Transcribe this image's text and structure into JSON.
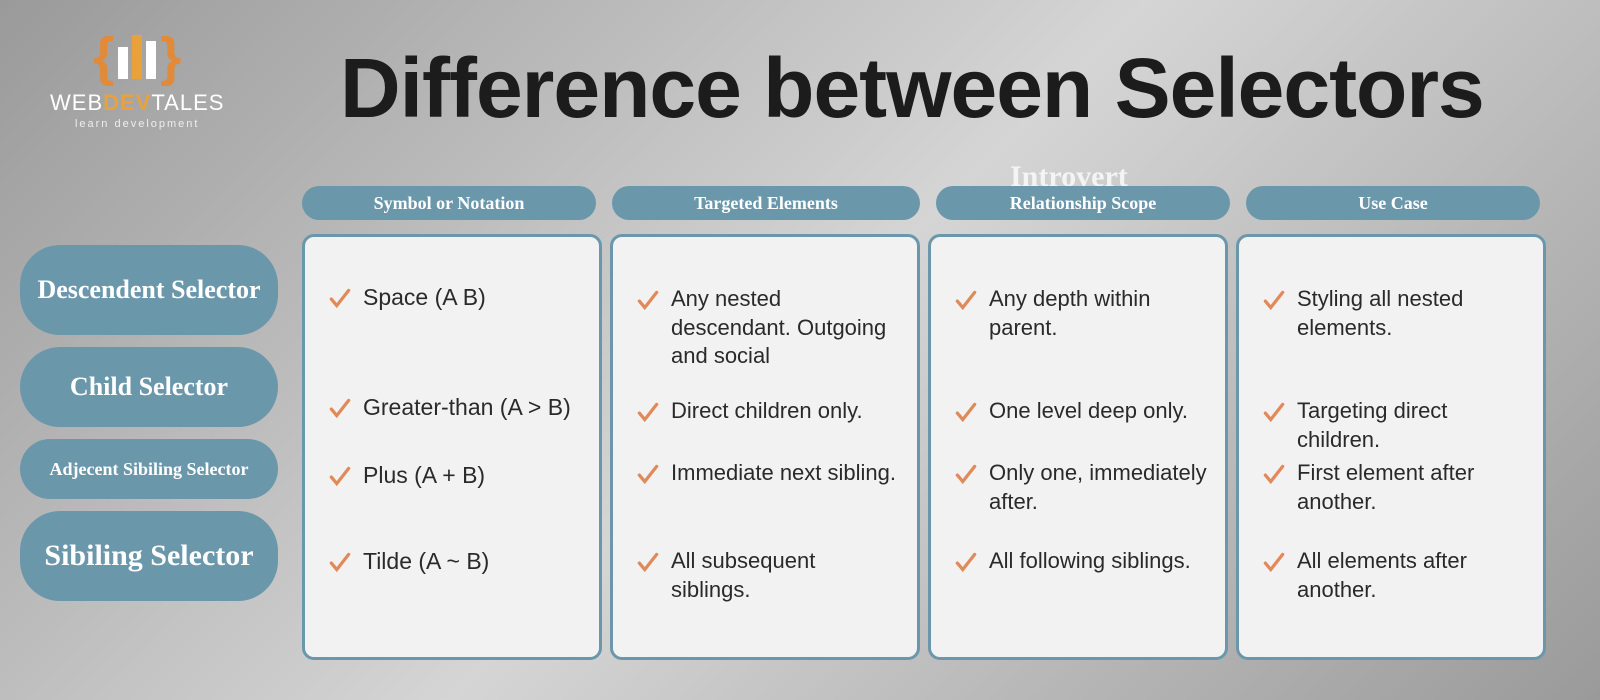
{
  "logo": {
    "line1_a": "WEB",
    "line1_b": "DEV",
    "line1_c": "TALES",
    "sub": "learn development"
  },
  "title": "Difference between Selectors",
  "stray": "Introvert",
  "rowLabels": [
    "Descendent Selector",
    "Child Selector",
    "Adjecent Sibiling Selector",
    "Sibiling Selector"
  ],
  "colHeaders": [
    "Symbol or Notation",
    "Targeted Elements",
    "Relationship Scope",
    "Use Case"
  ],
  "cells": {
    "c1": [
      "Space (A B)",
      "Greater-than (A > B)",
      "Plus (A + B)",
      "Tilde (A ~ B)"
    ],
    "c2": [
      "Any nested descendant. Outgoing and social",
      "Direct children only.",
      "Immediate next sibling.",
      "All subsequent siblings."
    ],
    "c3": [
      " Any depth within parent.",
      "One level deep only.",
      "Only one, immediately after.",
      "All following siblings."
    ],
    "c4": [
      "Styling all nested elements.",
      "Targeting direct children.",
      "First element after another.",
      "All elements after another."
    ]
  },
  "colors": {
    "pill": "#6b97ab",
    "check": "#e08a5a"
  }
}
